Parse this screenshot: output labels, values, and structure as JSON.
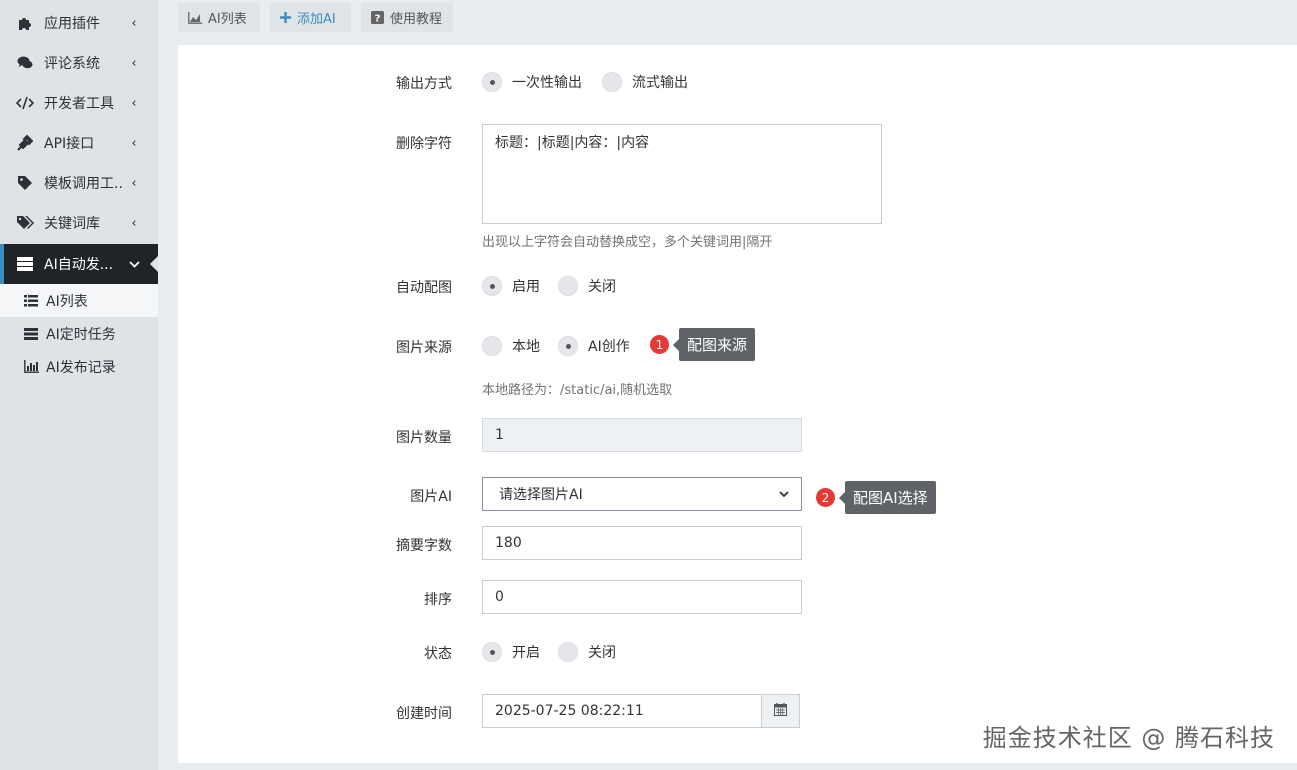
{
  "sidebar": {
    "items": [
      {
        "label": "应用插件",
        "icon": "puzzle-icon"
      },
      {
        "label": "评论系统",
        "icon": "comments-icon"
      },
      {
        "label": "开发者工具",
        "icon": "code-icon"
      },
      {
        "label": "API接口",
        "icon": "plug-icon"
      },
      {
        "label": "模板调用工...",
        "icon": "tag-icon"
      },
      {
        "label": "关键词库",
        "icon": "tags-icon"
      },
      {
        "label": "AI自动发...",
        "icon": "server-icon"
      }
    ],
    "sub_items": [
      {
        "label": "AI列表",
        "icon": "list-icon"
      },
      {
        "label": "AI定时任务",
        "icon": "tasks-icon"
      },
      {
        "label": "AI发布记录",
        "icon": "bar-chart-icon"
      }
    ]
  },
  "toolbar": {
    "list_label": "AI列表",
    "add_label": "添加AI",
    "help_label": "使用教程"
  },
  "form": {
    "output_mode": {
      "label": "输出方式",
      "options": [
        "一次性输出",
        "流式输出"
      ],
      "selected": "一次性输出"
    },
    "delete_chars": {
      "label": "删除字符",
      "value": "标题：|标题|内容：|内容",
      "help": "出现以上字符会自动替换成空，多个关键词用|隔开"
    },
    "auto_image": {
      "label": "自动配图",
      "options": [
        "启用",
        "关闭"
      ],
      "selected": "启用"
    },
    "image_source": {
      "label": "图片来源",
      "options": [
        "本地",
        "AI创作"
      ],
      "selected": "AI创作",
      "help": "本地路径为：/static/ai,随机选取"
    },
    "image_count": {
      "label": "图片数量",
      "value": "1"
    },
    "image_ai": {
      "label": "图片AI",
      "placeholder": "请选择图片AI"
    },
    "summary_chars": {
      "label": "摘要字数",
      "value": "180"
    },
    "sort": {
      "label": "排序",
      "value": "0"
    },
    "status": {
      "label": "状态",
      "options": [
        "开启",
        "关闭"
      ],
      "selected": "开启"
    },
    "created_at": {
      "label": "创建时间",
      "value": "2025-07-25 08:22:11"
    }
  },
  "callouts": [
    {
      "num": "1",
      "text": "配图来源"
    },
    {
      "num": "2",
      "text": "配图AI选择"
    }
  ],
  "watermark": "掘金技术社区 @ 腾石科技",
  "colors": {
    "accent": "#3c8dbc",
    "sidebar_active": "#1f2428",
    "callout_badge": "#e53935",
    "tooltip_bg": "#5f6368"
  }
}
